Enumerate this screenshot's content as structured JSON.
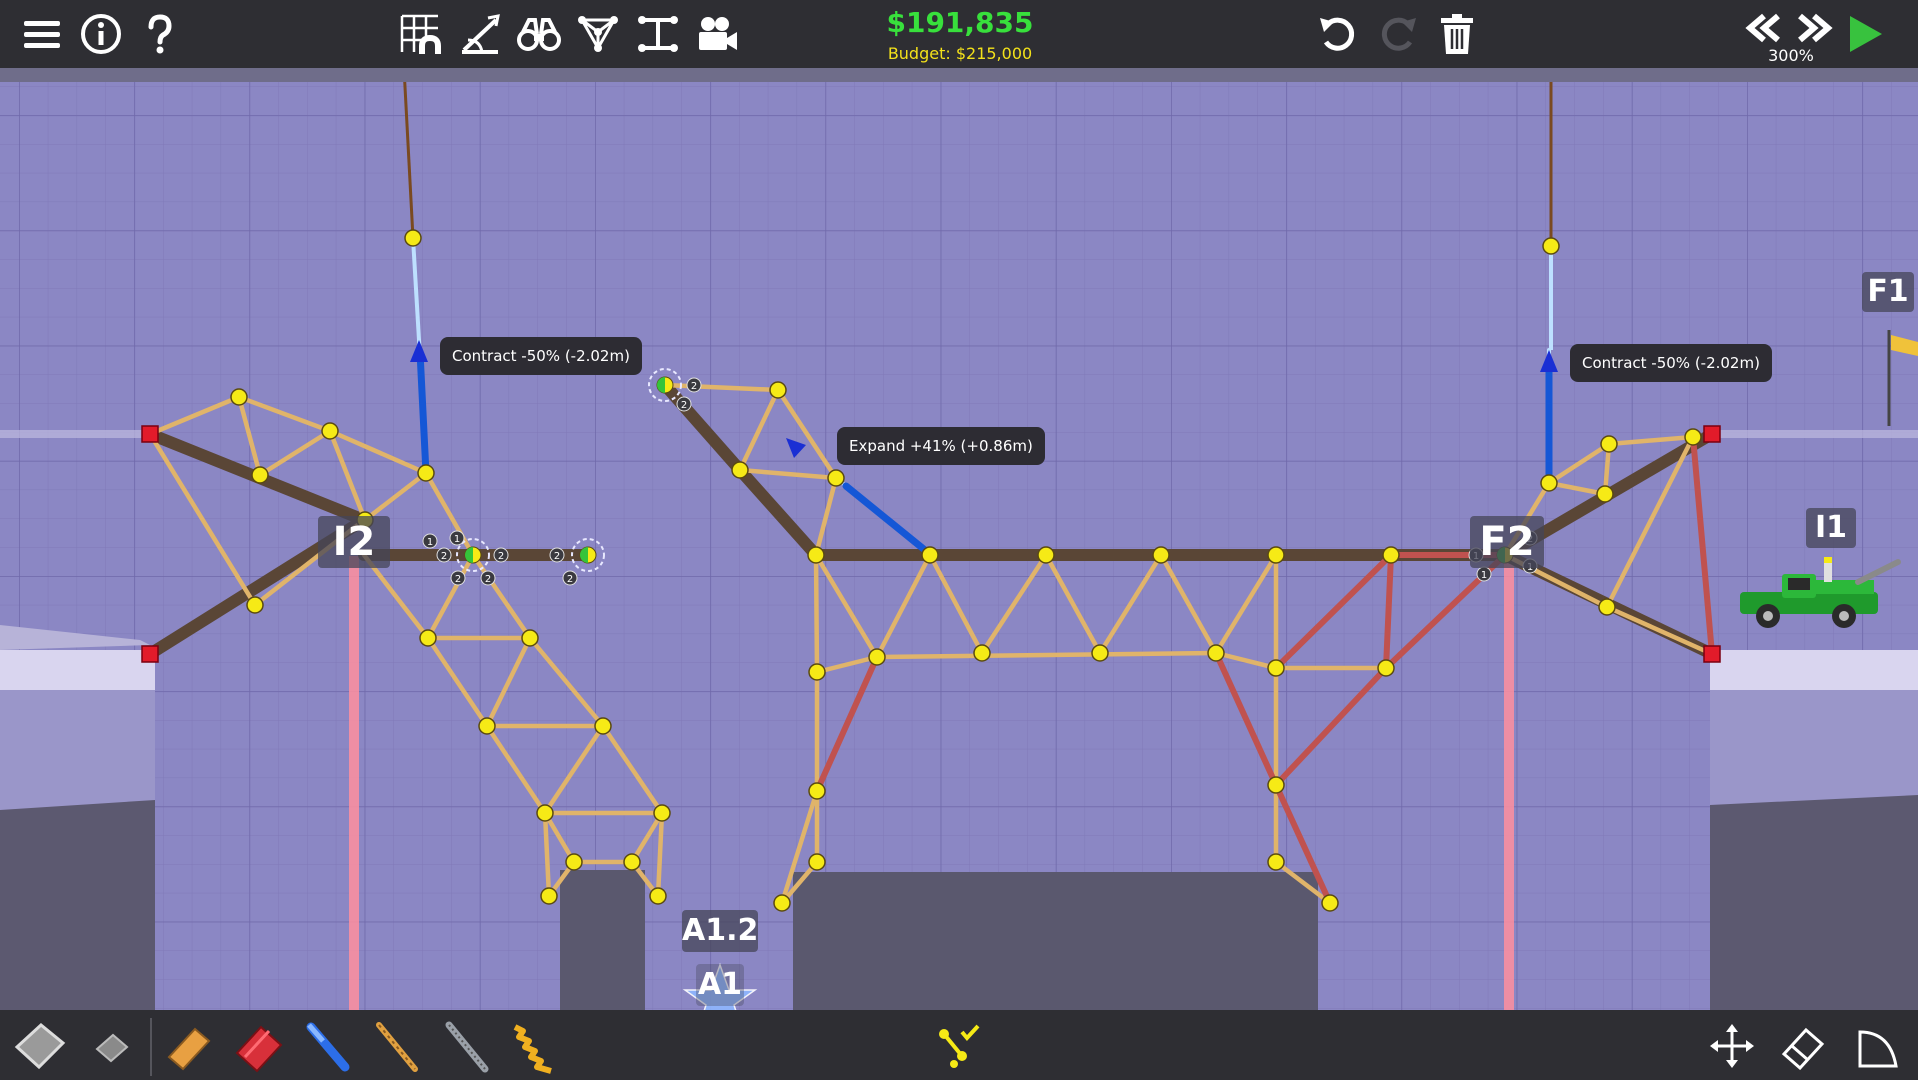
{
  "toolbar": {
    "money": "$191,835",
    "budget": "Budget: $215,000",
    "speed": "300%",
    "left_buttons": [
      "menu-icon",
      "info-icon",
      "help-icon"
    ],
    "center_buttons": [
      "grid-snap-icon",
      "stress-view-icon",
      "binoculars-icon",
      "hydraulic-phases-icon",
      "split-joint-icon",
      "camera-icon"
    ],
    "right_buttons": [
      "undo-icon",
      "redo-icon",
      "trash-icon"
    ],
    "playback_buttons": [
      "rewind-icon",
      "fast-forward-icon",
      "play-icon"
    ]
  },
  "tooltips": [
    {
      "id": "left-hydraulic",
      "text": "Contract -50% (-2.02m)"
    },
    {
      "id": "middle-hydraulic",
      "text": "Expand +41% (+0.86m)"
    },
    {
      "id": "right-hydraulic",
      "text": "Contract -50% (-2.02m)"
    }
  ],
  "checkpoints": {
    "i2": "I2",
    "f2": "F2",
    "f1": "F1",
    "i1": "I1",
    "a12": "A1.2",
    "a1": "A1"
  },
  "joint_badges": [
    "1",
    "2"
  ],
  "materials": [
    "road-icon",
    "reinforced-road-icon",
    "wood-icon",
    "steel-icon",
    "hydraulics-icon",
    "rope-icon",
    "cable-icon",
    "spring-icon"
  ],
  "bottom_center_icon": "hydraulic-check-icon",
  "bottom_right_buttons": [
    "pan-icon",
    "eraser-icon",
    "curve-icon"
  ],
  "colors": {
    "wood": "#e0b46a",
    "road": "#5a4636",
    "steel": "#c0524f",
    "hydraulic": "#1557d6",
    "joint": "#f6ea16",
    "anchor": "#e21b2a",
    "background": "#8b87c4",
    "money": "#38e03c",
    "budget": "#f3e11a"
  }
}
